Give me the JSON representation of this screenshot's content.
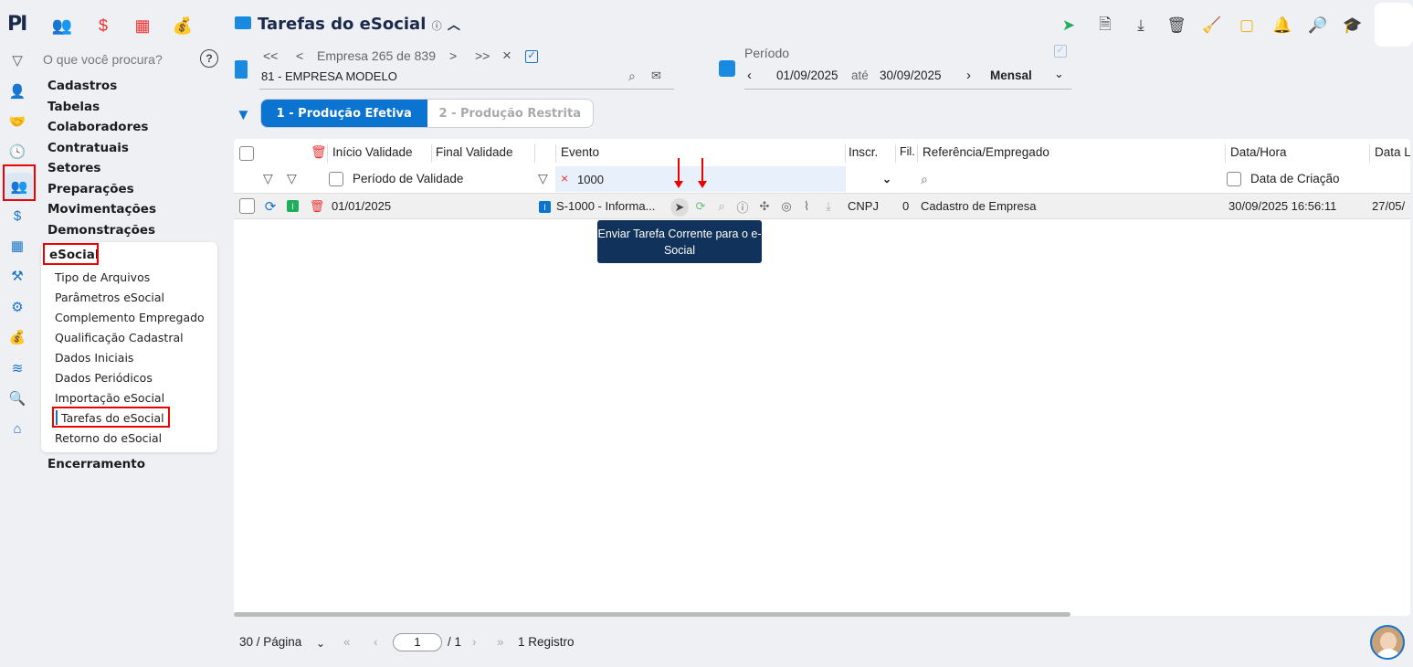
{
  "app": {
    "logo": "PI"
  },
  "search": {
    "placeholder": "O que você procura?",
    "help": "?"
  },
  "menu": {
    "items": [
      "Cadastros",
      "Tabelas",
      "Colaboradores",
      "Contratuais",
      "Setores",
      "Preparações",
      "Movimentações",
      "Demonstrações"
    ],
    "esocial_label": "eSocial",
    "esocial_sub": [
      "Tipo de Arquivos",
      "Parâmetros eSocial",
      "Complemento Empregado",
      "Qualificação Cadastral",
      "Dados Iniciais",
      "Dados Periódicos",
      "Importação eSocial",
      "Tarefas do eSocial",
      "Retorno do eSocial"
    ],
    "after": "Encerramento"
  },
  "header": {
    "title": "Tarefas do eSocial",
    "info": "ⓘ"
  },
  "company_nav": {
    "first": "<<",
    "prev": "<",
    "label": "Empresa 265 de 839",
    "next": ">",
    "last": ">>",
    "close": "×",
    "company": "81 - EMPRESA MODELO"
  },
  "period": {
    "label": "Período",
    "start": "01/09/2025",
    "until": "até",
    "end": "30/09/2025",
    "mode": "Mensal"
  },
  "tabs": [
    "1 - Produção Efetiva",
    "2 - Produção Restrita"
  ],
  "grid": {
    "headers": [
      "Início Validade",
      "Final Validade",
      "Evento",
      "Inscr.",
      "Fil.",
      "Referência/Empregado",
      "Data/Hora",
      "Data L"
    ],
    "filter_validity": "Período de Validade",
    "filter_event": "1000",
    "filter_created": "Data de Criação",
    "row": {
      "badge": "I",
      "inicio": "01/01/2025",
      "evento_badge": "I",
      "evento": "S-1000 - Informa...",
      "inscr": "CNPJ",
      "fil": "0",
      "referencia": "Cadastro de Empresa",
      "datahora": "30/09/2025 16:56:11",
      "datal": "27/05/"
    },
    "tooltip": "Enviar Tarefa Corrente para o e-Social"
  },
  "pagination": {
    "per_page": "30 / Página",
    "page": "1",
    "total_pages": "/ 1",
    "records": "1 Registro"
  },
  "colors": {
    "accent": "#0b73d0",
    "highlight": "#e00000",
    "tooltip": "#11325a"
  }
}
